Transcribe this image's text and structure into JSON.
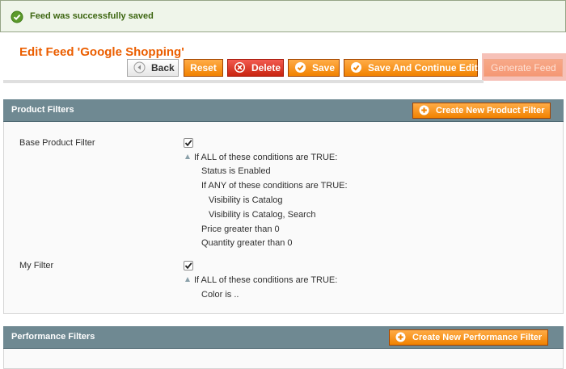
{
  "message": {
    "text": "Feed was successfully saved",
    "icon": "check-circle-icon"
  },
  "header": {
    "title": "Edit Feed 'Google Shopping'",
    "buttons": {
      "back": "Back",
      "reset": "Reset",
      "delete": "Delete",
      "save": "Save",
      "save_continue": "Save And Continue Edit",
      "generate": "Generate Feed"
    }
  },
  "product_filters": {
    "title": "Product Filters",
    "create_button": "Create New Product Filter",
    "filters": [
      {
        "label": "Base Product Filter",
        "checked": true,
        "conditions": [
          "If ALL of these conditions are TRUE:",
          "Status is Enabled",
          "If ANY of these conditions are TRUE:",
          "Visibility is Catalog",
          "Visibility is Catalog, Search",
          "Price greater than 0",
          "Quantity greater than 0"
        ]
      },
      {
        "label": "My Filter",
        "checked": true,
        "conditions": [
          "If ALL of these conditions are TRUE:",
          "Color is .."
        ]
      }
    ]
  },
  "performance_filters": {
    "title": "Performance Filters",
    "create_button": "Create New Performance Filter"
  },
  "colors": {
    "accent": "#eb5e00",
    "button": "#f18200",
    "delete": "#c9240f",
    "section_header": "#6f8992",
    "success_bg": "#eff5ea",
    "success_text": "#3d6611"
  }
}
